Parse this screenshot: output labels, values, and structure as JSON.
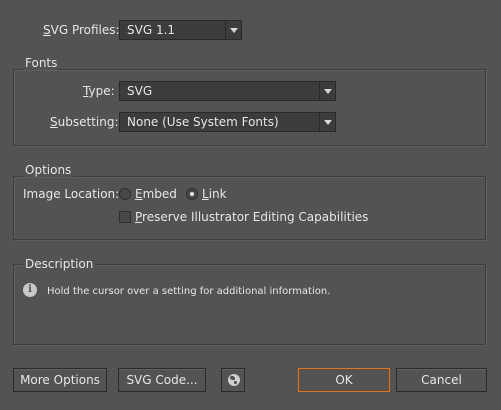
{
  "profiles": {
    "label_prefix": "S",
    "label_rest": "VG Profiles:",
    "value": "SVG 1.1"
  },
  "fonts": {
    "title": "Fonts",
    "type_label_prefix": "",
    "type_label_u": "T",
    "type_label_rest": "ype:",
    "type_value": "SVG",
    "subsetting_label_u": "S",
    "subsetting_label_rest": "ubsetting:",
    "subsetting_value": "None (Use System Fonts)"
  },
  "options": {
    "title": "Options",
    "image_location_label": "Image Location:",
    "embed_label_u": "E",
    "embed_label_rest": "mbed",
    "link_label_u": "L",
    "link_label_rest": "ink",
    "selected": "Link",
    "preserve_label_u": "P",
    "preserve_label_rest": "reserve Illustrator Editing Capabilities",
    "preserve_checked": false
  },
  "description": {
    "title": "Description",
    "text": "Hold the cursor over a setting for additional information."
  },
  "buttons": {
    "more_options": "More Options",
    "svg_code": "SVG Code...",
    "ok": "OK",
    "cancel": "Cancel"
  },
  "colors": {
    "background": "#535353",
    "accent": "#d9782b"
  }
}
